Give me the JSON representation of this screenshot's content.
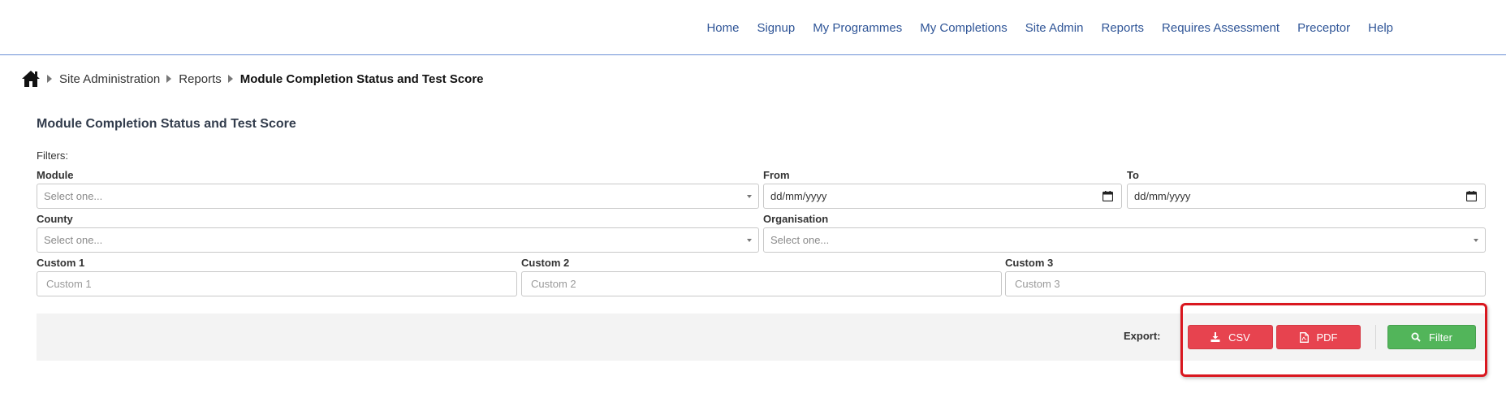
{
  "nav": {
    "items": [
      {
        "label": "Home"
      },
      {
        "label": "Signup"
      },
      {
        "label": "My Programmes"
      },
      {
        "label": "My Completions"
      },
      {
        "label": "Site Admin"
      },
      {
        "label": "Reports"
      },
      {
        "label": "Requires Assessment"
      },
      {
        "label": "Preceptor"
      },
      {
        "label": "Help"
      }
    ]
  },
  "breadcrumb": {
    "home_icon": "home-icon",
    "items": [
      "Site Administration",
      "Reports"
    ],
    "current": "Module Completion Status and Test Score"
  },
  "page": {
    "title": "Module Completion Status and Test Score",
    "filters_label": "Filters:"
  },
  "filters": {
    "module": {
      "label": "Module",
      "placeholder": "Select one..."
    },
    "from": {
      "label": "From",
      "value": "dd/mm/yyyy"
    },
    "to": {
      "label": "To",
      "value": "dd/mm/yyyy"
    },
    "county": {
      "label": "County",
      "placeholder": "Select one..."
    },
    "organisation": {
      "label": "Organisation",
      "placeholder": "Select one..."
    },
    "custom1": {
      "label": "Custom 1",
      "placeholder": "Custom 1"
    },
    "custom2": {
      "label": "Custom 2",
      "placeholder": "Custom 2"
    },
    "custom3": {
      "label": "Custom 3",
      "placeholder": "Custom 3"
    }
  },
  "actions": {
    "export_label": "Export:",
    "csv_label": "CSV",
    "pdf_label": "PDF",
    "filter_label": "Filter"
  },
  "colors": {
    "nav_link": "#2f5597",
    "export_button": "#e7434f",
    "filter_button": "#52b55a",
    "highlight": "#d9171f"
  }
}
